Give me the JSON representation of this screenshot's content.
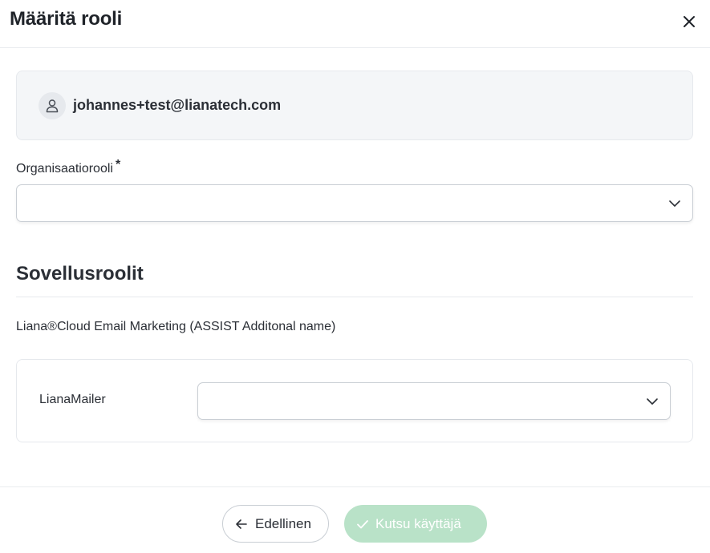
{
  "modal": {
    "title": "Määritä rooli",
    "close_icon": "close-icon"
  },
  "user": {
    "icon": "user-icon",
    "email": "johannes+test@lianatech.com"
  },
  "organization_role": {
    "label": "Organisaatiorooli",
    "required_mark": "*",
    "selected_value": ""
  },
  "app_roles": {
    "title": "Sovellusroolit",
    "application_name": "Liana®Cloud Email Marketing (ASSIST Additonal name)",
    "roles": [
      {
        "label": "LianaMailer",
        "selected_value": ""
      }
    ]
  },
  "footer": {
    "back_label": "Edellinen",
    "back_icon": "arrow-left-icon",
    "invite_label": "Kutsu käyttäjä",
    "invite_icon": "check-icon"
  },
  "colors": {
    "primary_disabled": "#b9e2c8",
    "card_background": "#f4f6f8",
    "text": "#2b2f36"
  }
}
